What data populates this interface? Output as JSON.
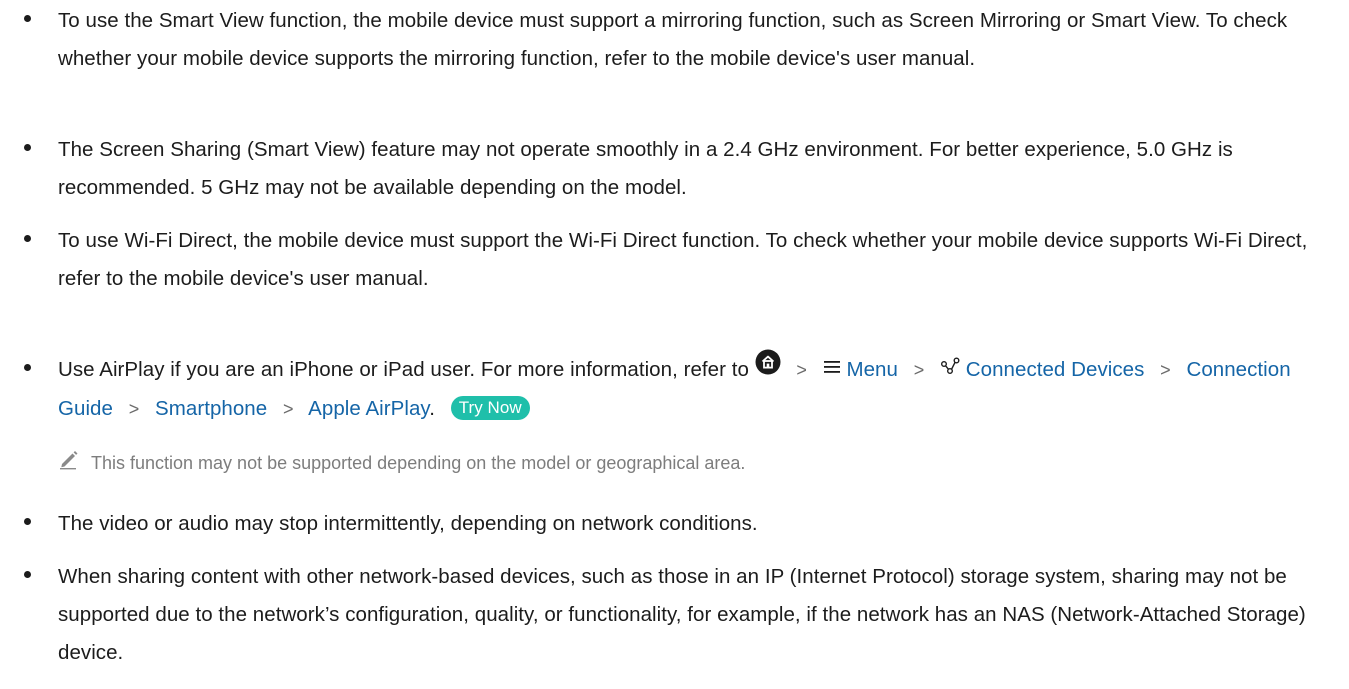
{
  "bullets": [
    "To use the Smart View function, the mobile device must support a mirroring function, such as Screen Mirroring or Smart View. To check whether your mobile device supports the mirroring function, refer to the mobile device's user manual.",
    "The Screen Sharing (Smart View) feature may not operate smoothly in a 2.4 GHz environment. For better experience, 5.0 GHz is recommended. 5 GHz may not be available depending on the model.",
    "To use Wi-Fi Direct, the mobile device must support the Wi-Fi Direct function. To check whether your mobile device supports Wi-Fi Direct, refer to the mobile device's user manual."
  ],
  "airplay": {
    "prefix": "Use AirPlay if you are an iPhone or iPad user. For more information, refer to",
    "path": {
      "menu": "Menu",
      "connected_devices": "Connected Devices",
      "connection_guide": "Connection Guide",
      "smartphone": "Smartphone",
      "apple_airplay": "Apple AirPlay"
    },
    "period": ".",
    "try_now": "Try Now",
    "note": "This function may not be supported depending on the model or geographical area."
  },
  "bullets_after": [
    "The video or audio may stop intermittently, depending on network conditions.",
    "When sharing content with other network-based devices, such as those in an IP (Internet Protocol) storage system, sharing may not be supported due to the network’s configuration, quality, or functionality, for example, if the network has an NAS (Network-Attached Storage) device."
  ],
  "icons": {
    "home": "home-icon",
    "menu": "hamburger-menu-icon",
    "connected": "connected-devices-icon",
    "separator": "chevron-right-icon",
    "note": "pencil-icon"
  },
  "colors": {
    "link": "#1565a7",
    "try_now_bg": "#1fbfaa",
    "text": "#1c1c1c",
    "note_text": "#7d7d7d"
  }
}
